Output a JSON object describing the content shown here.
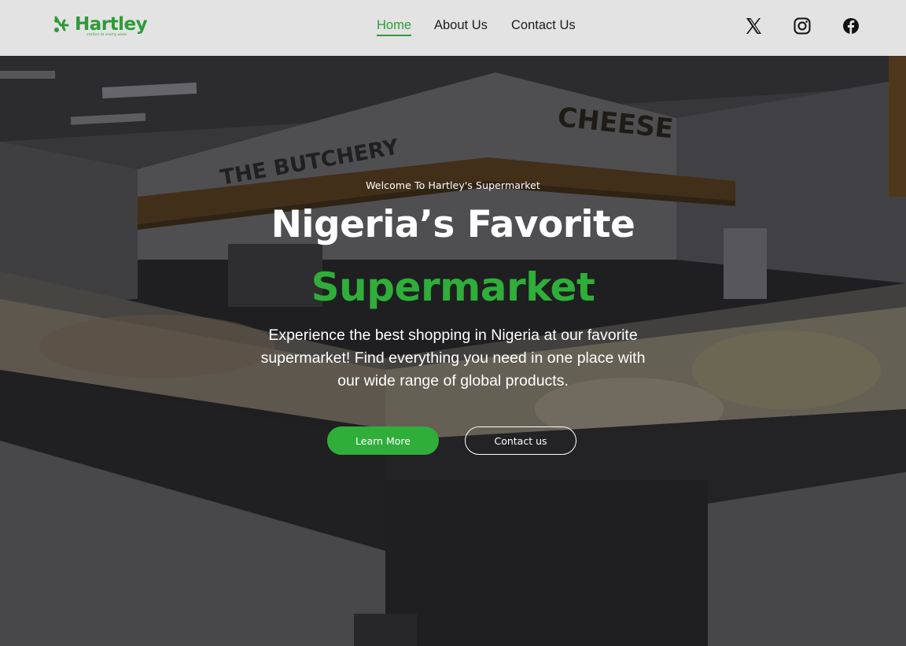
{
  "header": {
    "brand": "Hartley",
    "tagline": "smiles in every aisle",
    "nav": [
      {
        "label": "Home",
        "active": true
      },
      {
        "label": "About Us",
        "active": false
      },
      {
        "label": "Contact Us",
        "active": false
      }
    ],
    "social": [
      "x-icon",
      "instagram-icon",
      "facebook-icon"
    ]
  },
  "hero": {
    "welcome": "Welcome To Hartley's Supermarket",
    "headline_line1": "Nigeria’s Favorite",
    "headline_line2": "Supermarket",
    "description": "Experience the best shopping in Nigeria at our favorite supermarket! Find everything you need in one place with our wide range of global products.",
    "learn_more_label": "Learn More",
    "contact_label": "Contact us",
    "background_signs": [
      "THE BUTCHERY",
      "CHEESE"
    ]
  },
  "colors": {
    "brand_green": "#2fae3a",
    "header_bg": "#e3e3e3",
    "text_dark": "#1d1d1d"
  }
}
